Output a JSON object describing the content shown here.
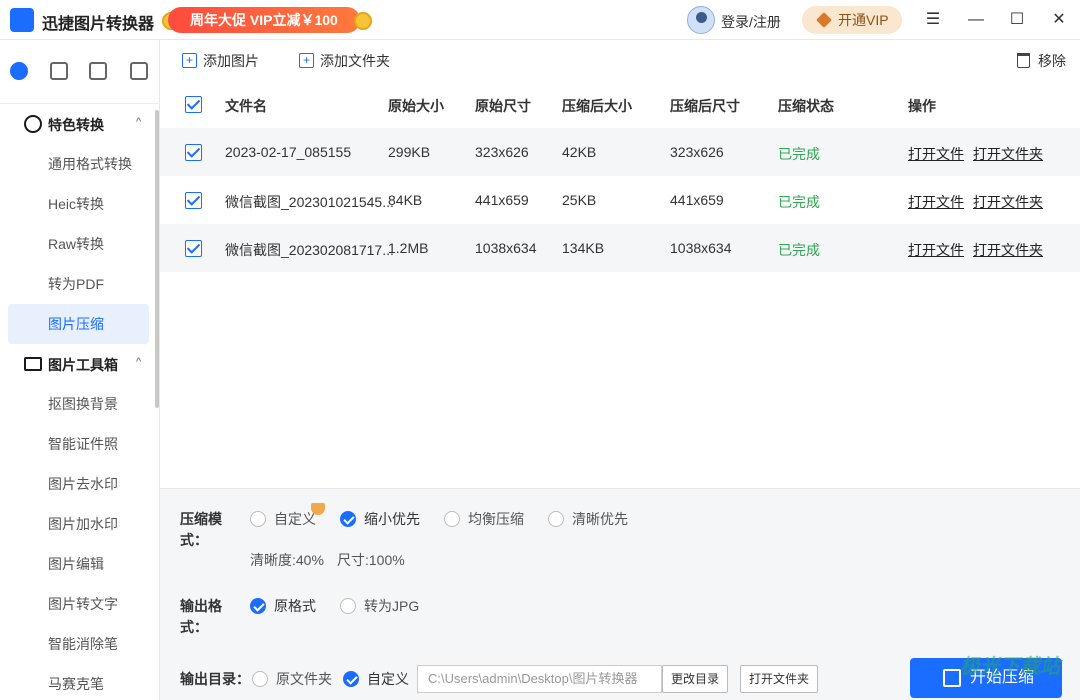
{
  "app": {
    "title": "迅捷图片转换器",
    "promo": "周年大促 VIP立减￥100",
    "login": "登录/注册",
    "vip": "开通VIP"
  },
  "sidebar": {
    "groups": [
      {
        "label": "特色转换",
        "items": [
          "通用格式转换",
          "Heic转换",
          "Raw转换",
          "转为PDF",
          "图片压缩"
        ]
      },
      {
        "label": "图片工具箱",
        "items": [
          "抠图换背景",
          "智能证件照",
          "图片去水印",
          "图片加水印",
          "图片编辑",
          "图片转文字",
          "智能消除笔",
          "马赛克笔"
        ]
      }
    ],
    "active_item": "图片压缩"
  },
  "toolbar": {
    "add_image": "添加图片",
    "add_folder": "添加文件夹",
    "remove": "移除"
  },
  "table": {
    "headers": [
      "文件名",
      "原始大小",
      "原始尺寸",
      "压缩后大小",
      "压缩后尺寸",
      "压缩状态",
      "操作"
    ],
    "rows": [
      {
        "name": "2023-02-17_085155",
        "orig_size": "299KB",
        "orig_dim": "323x626",
        "new_size": "42KB",
        "new_dim": "323x626",
        "status": "已完成",
        "open_file": "打开文件",
        "open_folder": "打开文件夹"
      },
      {
        "name": "微信截图_202301021545...",
        "orig_size": "84KB",
        "orig_dim": "441x659",
        "new_size": "25KB",
        "new_dim": "441x659",
        "status": "已完成",
        "open_file": "打开文件",
        "open_folder": "打开文件夹"
      },
      {
        "name": "微信截图_202302081717...",
        "orig_size": "1.2MB",
        "orig_dim": "1038x634",
        "new_size": "134KB",
        "new_dim": "1038x634",
        "status": "已完成",
        "open_file": "打开文件",
        "open_folder": "打开文件夹"
      }
    ]
  },
  "settings": {
    "mode_label_1": "压缩模",
    "mode_label_2": "式：",
    "modes": [
      "自定义",
      "缩小优先",
      "均衡压缩",
      "清晰优先"
    ],
    "mode_selected": "缩小优先",
    "clarity": "清晰度:40%",
    "size": "尺寸:100%",
    "format_label_1": "输出格",
    "format_label_2": "式：",
    "formats": [
      "原格式",
      "转为JPG"
    ],
    "format_selected": "原格式",
    "dir_label": "输出目录：",
    "dirs": [
      "原文件夹",
      "自定义"
    ],
    "dir_selected": "自定义",
    "path": "C:\\Users\\admin\\Desktop\\图片转换器",
    "change_dir": "更改目录",
    "open_folder": "打开文件夹",
    "start": "开始压缩"
  },
  "watermark": "极光下载站"
}
